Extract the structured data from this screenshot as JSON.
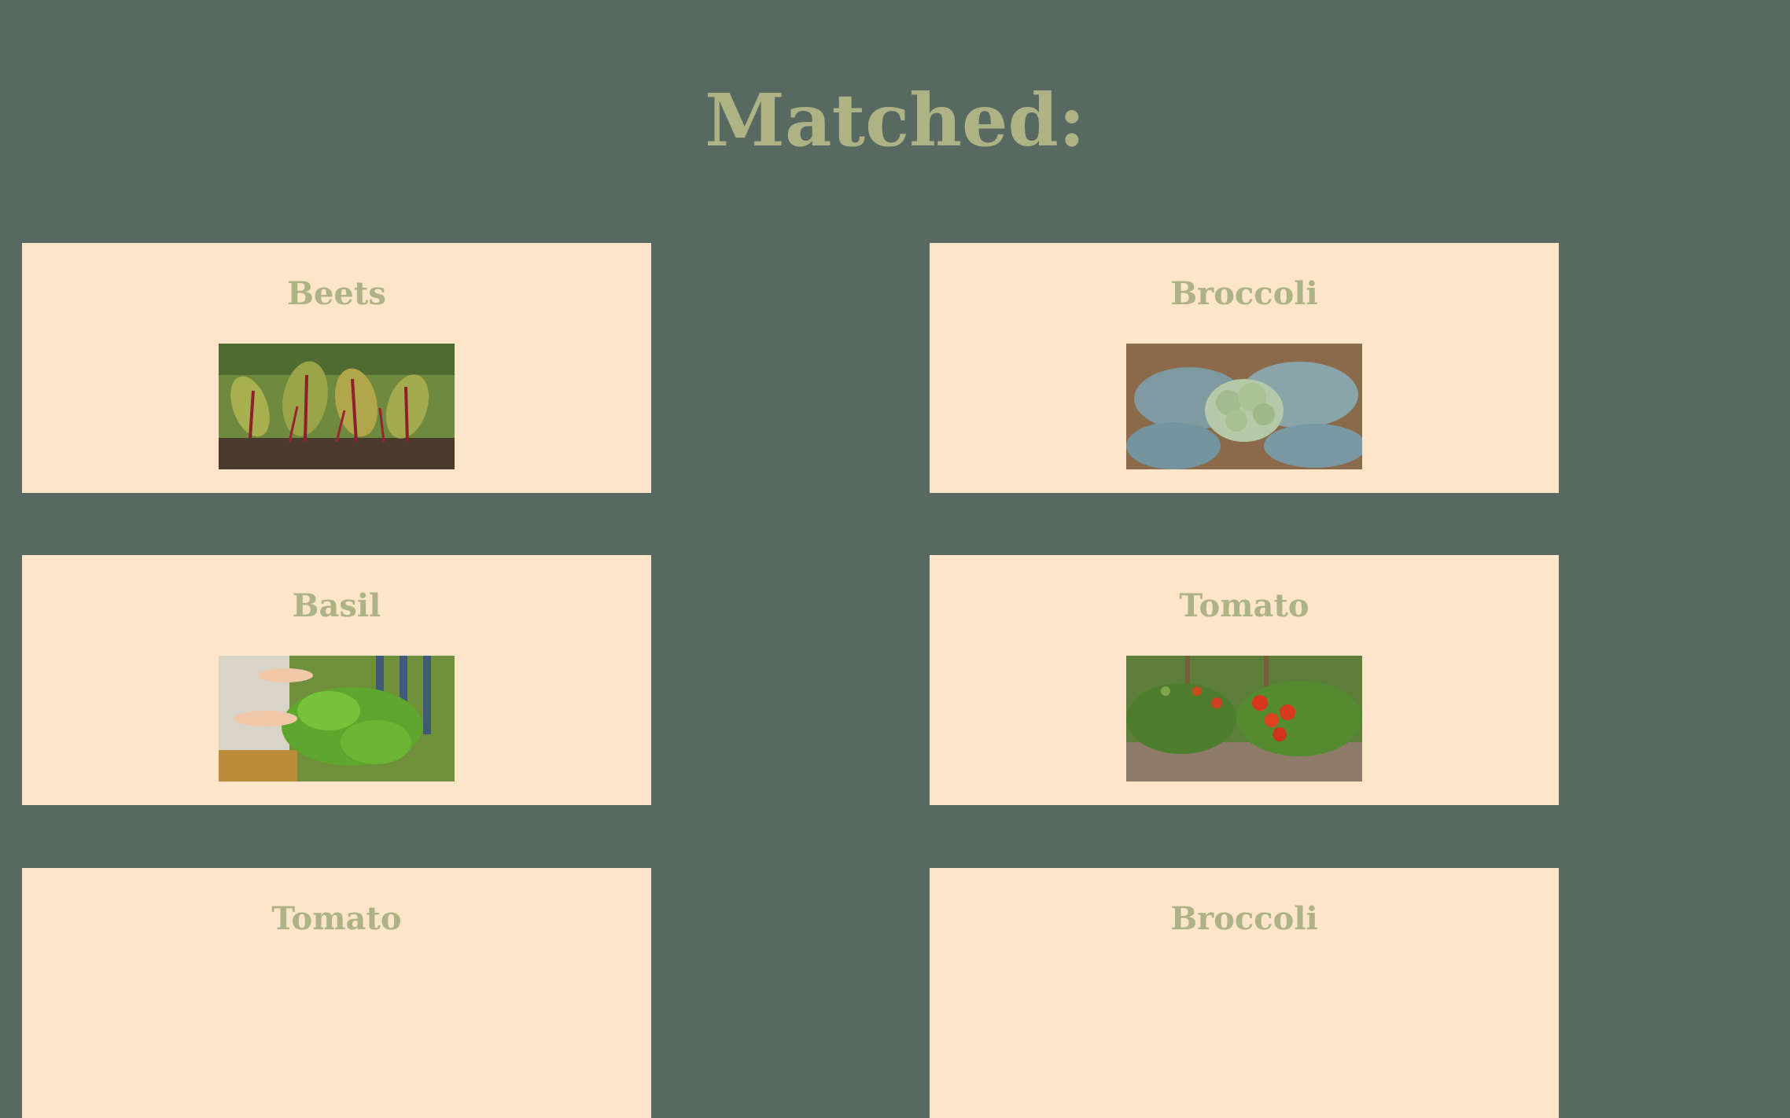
{
  "page": {
    "title": "Matched:"
  },
  "cards": [
    {
      "name": "Beets",
      "image": "beets-photo"
    },
    {
      "name": "Broccoli",
      "image": "broccoli-photo"
    },
    {
      "name": "Basil",
      "image": "basil-photo"
    },
    {
      "name": "Tomato",
      "image": "tomato-photo"
    },
    {
      "name": "Tomato",
      "image": "tomato-photo"
    },
    {
      "name": "Broccoli",
      "image": "broccoli-photo"
    }
  ],
  "colors": {
    "background": "#576961",
    "card": "#fce5c8",
    "heading": "#aeb386"
  }
}
